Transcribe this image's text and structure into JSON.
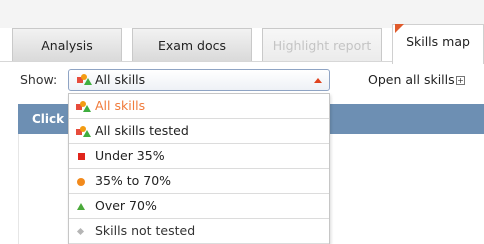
{
  "tabs": [
    {
      "label": "Analysis",
      "state": "normal"
    },
    {
      "label": "Exam docs",
      "state": "normal"
    },
    {
      "label": "Highlight report",
      "state": "disabled"
    },
    {
      "label": "Skills map",
      "state": "active"
    }
  ],
  "filter": {
    "label": "Show:",
    "selected": "All skills",
    "open_all_label": "Open all skills",
    "expand_symbol": "+"
  },
  "banner": {
    "text": "Click"
  },
  "options": [
    {
      "label": "All skills",
      "icon": "skills-mix-icon",
      "highlighted": true
    },
    {
      "label": "All skills tested",
      "icon": "skills-mix-icon"
    },
    {
      "label": "Under 35%",
      "icon": "red-square-icon",
      "color": "#e0241b"
    },
    {
      "label": "35% to 70%",
      "icon": "orange-circle-icon",
      "color": "#f28a1c"
    },
    {
      "label": "Over 70%",
      "icon": "green-triangle-icon",
      "color": "#4aa93a"
    },
    {
      "label": "Skills not tested",
      "icon": "grey-diamond-icon",
      "color": "#b5b5b5"
    }
  ],
  "colors": {
    "banner": "#6d8fb3",
    "highlight_text": "#f07a3a",
    "caret": "#e0431e",
    "tab_flag": "#e05a2b"
  }
}
